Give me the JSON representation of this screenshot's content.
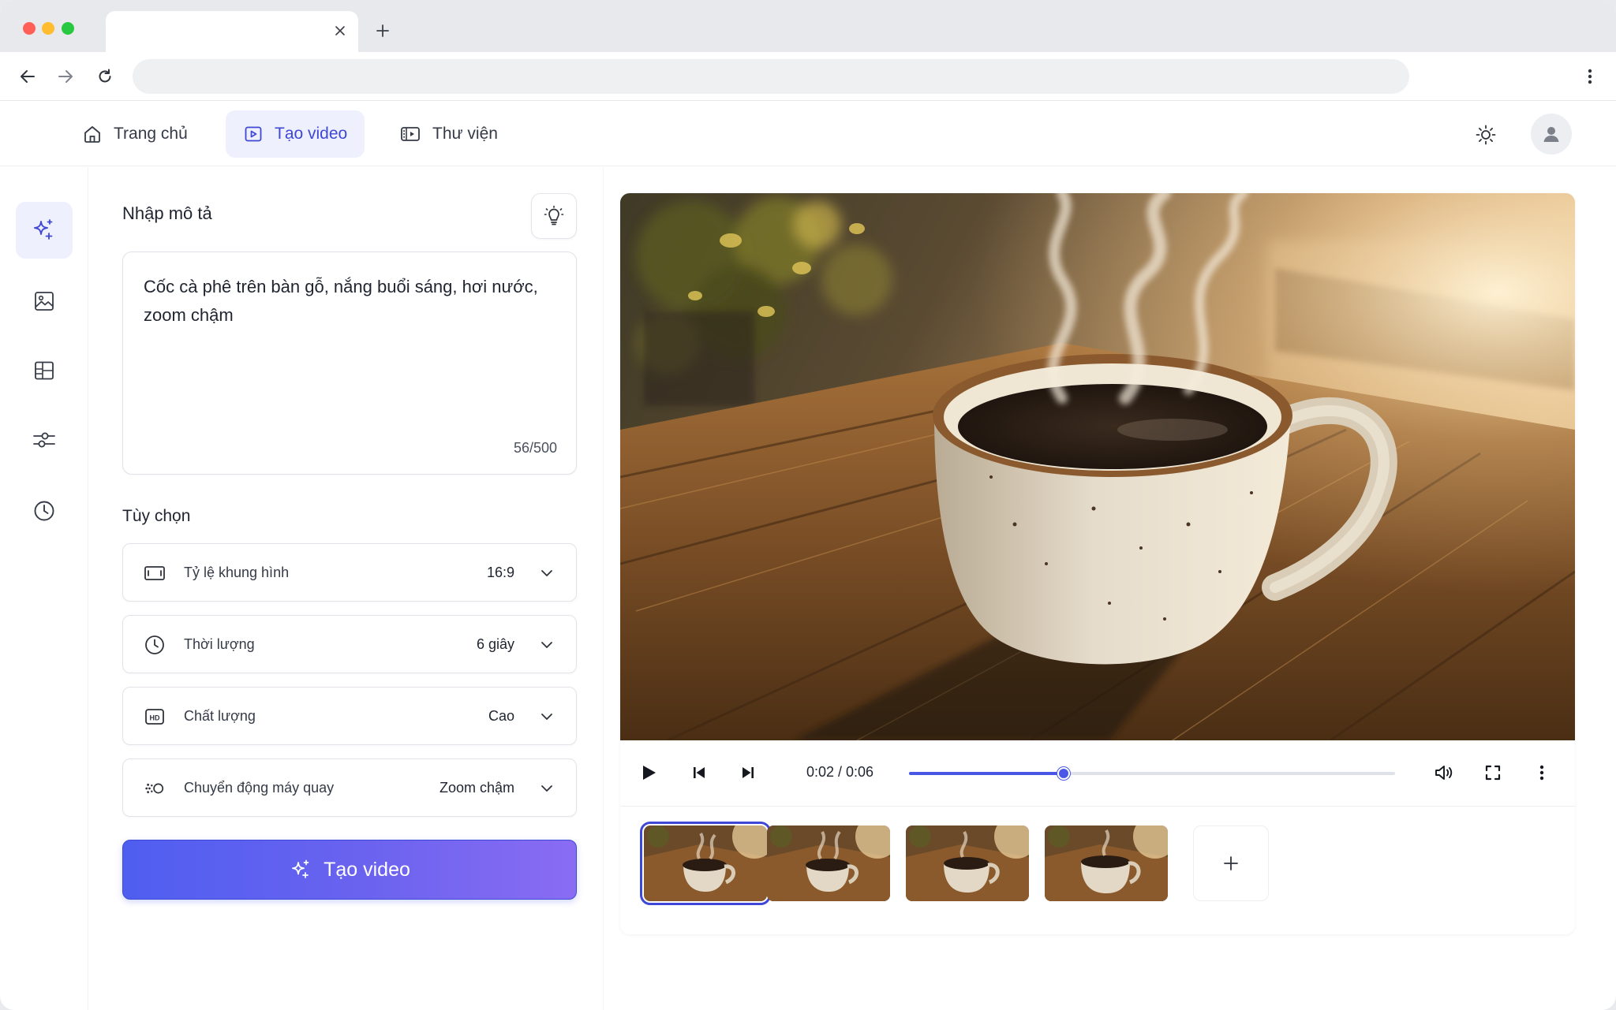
{
  "browser": {
    "tab_title": "",
    "address": "",
    "icons": [
      "close-icon",
      "plus-icon",
      "arrow-left-icon",
      "arrow-right-icon",
      "refresh-icon",
      "more-vertical-icon"
    ]
  },
  "nav": {
    "items": [
      {
        "label": "Trang chủ",
        "icon": "home-icon",
        "active": false
      },
      {
        "label": "Tạo video",
        "icon": "video-play-icon",
        "active": true
      },
      {
        "label": "Thư viện",
        "icon": "film-library-icon",
        "active": false
      }
    ],
    "theme_icon": "sun-icon",
    "avatar_icon": "user-icon"
  },
  "rail": {
    "items": [
      {
        "icon": "sparkle-icon",
        "active": true
      },
      {
        "icon": "image-icon",
        "active": false
      },
      {
        "icon": "layout-icon",
        "active": false
      },
      {
        "icon": "sliders-icon",
        "active": false
      },
      {
        "icon": "clock-icon",
        "active": false
      }
    ]
  },
  "prompt": {
    "title": "Nhập mô tả",
    "idea_icon": "lightbulb-icon",
    "text": "Cốc cà phê trên bàn gỗ, nắng buổi sáng, hơi nước, zoom chậm",
    "count": "56/500"
  },
  "options": {
    "title": "Tùy chọn",
    "items": [
      {
        "icon": "aspect-ratio-icon",
        "label": "Tỷ lệ khung hình",
        "value": "16:9"
      },
      {
        "icon": "clock-icon",
        "label": "Thời lượng",
        "value": "6 giây"
      },
      {
        "icon": "hd-icon",
        "label": "Chất lượng",
        "value": "Cao"
      },
      {
        "icon": "camera-motion-icon",
        "label": "Chuyển động máy quay",
        "value": "Zoom chậm"
      }
    ]
  },
  "generate": {
    "label": "Tạo video",
    "icon": "sparkle-icon"
  },
  "player": {
    "time": "0:02 / 0:06",
    "progress": 0.318,
    "icons": [
      "play-icon",
      "skip-back-icon",
      "skip-forward-icon",
      "volume-icon",
      "fullscreen-icon",
      "more-vertical-icon"
    ]
  },
  "thumbnails": {
    "count": 4,
    "selected_index": 0,
    "add_icon": "plus-icon"
  },
  "colors": {
    "accent": "#3f48d6",
    "accent_soft": "#eef0fd",
    "button_gradient_start": "#4f5ef0",
    "button_gradient_end": "#8a6cf3"
  }
}
